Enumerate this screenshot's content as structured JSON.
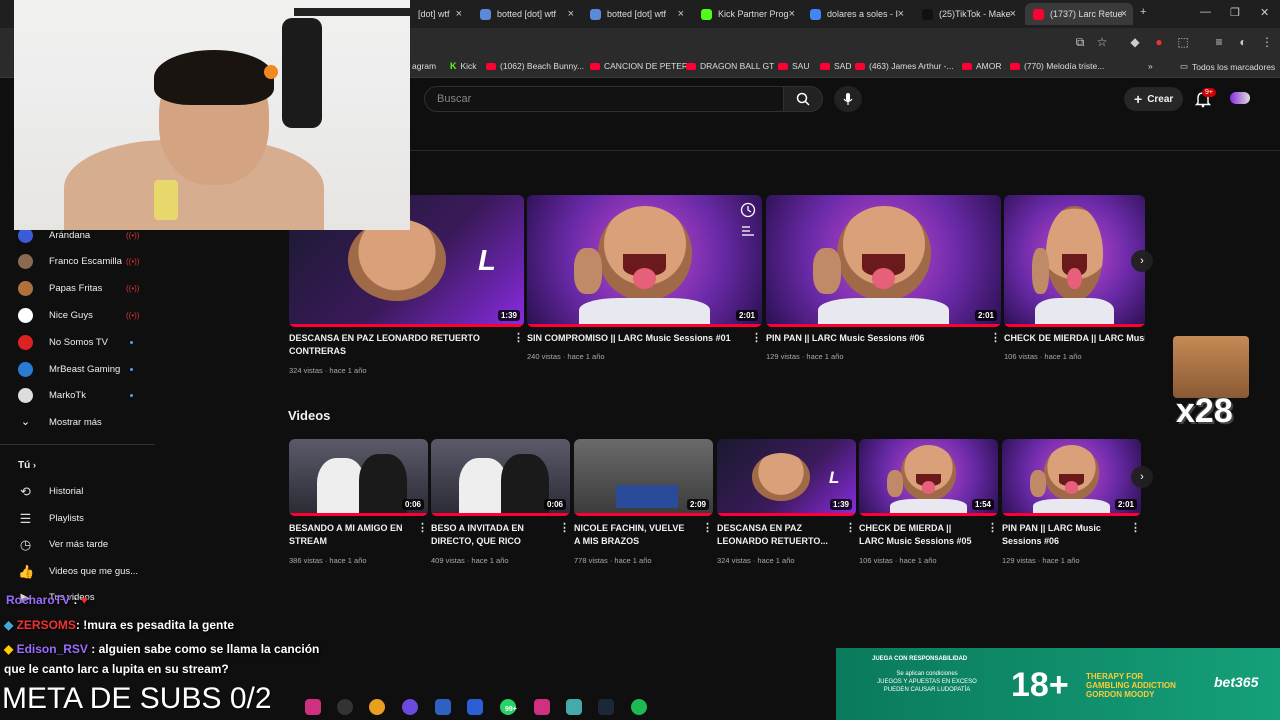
{
  "browser": {
    "tabs": [
      {
        "label": "[dot] wtf",
        "color": "#4a7bd0"
      },
      {
        "label": "botted [dot] wtf",
        "color": "#5a8ad8"
      },
      {
        "label": "botted [dot] wtf",
        "color": "#5a8ad8"
      },
      {
        "label": "Kick Partner Prog",
        "color": "#53fc18"
      },
      {
        "label": "dolares a soles - I",
        "color": "#4285f4"
      },
      {
        "label": "(25)TikTok - Make",
        "color": "#111111"
      },
      {
        "label": "(1737) Larc Retue",
        "color": "#ff0033"
      }
    ],
    "tab_close": "×",
    "new_tab": "+",
    "window_controls": {
      "minimize": "—",
      "maximize": "❐",
      "close": "✕"
    },
    "bookmarks": [
      {
        "label": "agram",
        "type": "plain"
      },
      {
        "label": "Kick",
        "type": "kick"
      },
      {
        "label": "(1062) Beach Bunny...",
        "type": "yt"
      },
      {
        "label": "CANCION DE PETER",
        "type": "yt"
      },
      {
        "label": "DRAGON BALL GT",
        "type": "yt"
      },
      {
        "label": "SAU",
        "type": "yt"
      },
      {
        "label": "SAD",
        "type": "yt"
      },
      {
        "label": "(463) James Arthur -...",
        "type": "yt"
      },
      {
        "label": "AMOR",
        "type": "yt"
      },
      {
        "label": "(770) Melodía triste...",
        "type": "yt"
      }
    ],
    "bookmarks_more": "»",
    "all_bookmarks": "Todos los marcadores"
  },
  "header": {
    "search_placeholder": "Buscar",
    "create_label": "Crear",
    "notif_badge": "9+"
  },
  "sidebar": {
    "subscriptions": [
      {
        "label": "Arándana",
        "status": "live",
        "color": "#3b5bdb"
      },
      {
        "label": "Franco Escamilla",
        "status": "live",
        "color": "#8a6a50"
      },
      {
        "label": "Papas Fritas",
        "status": "live",
        "color": "#b0703a"
      },
      {
        "label": "Nice Guys",
        "status": "live",
        "color": "#ffffff"
      },
      {
        "label": "No Somos TV",
        "status": "dot",
        "color": "#d22"
      },
      {
        "label": "MrBeast Gaming",
        "status": "dot",
        "color": "#2a7bd4"
      },
      {
        "label": "MarkoTk",
        "status": "dot",
        "color": "#dddddd"
      }
    ],
    "show_more": "Mostrar más",
    "you_label": "Tú",
    "library": [
      {
        "label": "Historial",
        "icon": "history-icon",
        "glyph": "⟲"
      },
      {
        "label": "Playlists",
        "icon": "playlists-icon",
        "glyph": "☰"
      },
      {
        "label": "Ver más tarde",
        "icon": "clock-icon",
        "glyph": "◷"
      },
      {
        "label": "Videos que me gus...",
        "icon": "thumbs-up-icon",
        "glyph": "👍"
      },
      {
        "label": "Tus videos",
        "icon": "video-icon",
        "glyph": "▶"
      }
    ]
  },
  "shorts_row": [
    {
      "title": "DESCANSA EN PAZ LEONARDO RETUERTO CONTRERAS",
      "meta": "324 vistas · hace 1 año",
      "duration": "1:39"
    },
    {
      "title": "SIN COMPROMISO || LARC Music Sessions #01",
      "meta": "240 vistas · hace 1 año",
      "duration": "2:01"
    },
    {
      "title": "PIN PAN || LARC Music Sessions #06",
      "meta": "129 vistas · hace 1 año",
      "duration": "2:01"
    },
    {
      "title": "CHECK DE MIERDA || LARC Music",
      "meta": "106 vistas · hace 1 año",
      "duration": ""
    }
  ],
  "videos_section": {
    "title": "Videos",
    "items": [
      {
        "title": "BESANDO A MI AMIGO EN STREAM",
        "meta": "386 vistas · hace 1 año",
        "duration": "0:06"
      },
      {
        "title": "BESO A INVITADA EN DIRECTO, QUE RICO",
        "meta": "409 vistas · hace 1 año",
        "duration": "0:06"
      },
      {
        "title": "NICOLE FACHIN, VUELVE A MIS BRAZOS",
        "meta": "778 vistas · hace 1 año",
        "duration": "2:09"
      },
      {
        "title": "DESCANSA EN PAZ LEONARDO RETUERTO...",
        "meta": "324 vistas · hace 1 año",
        "duration": "1:39"
      },
      {
        "title": "CHECK DE MIERDA || LARC Music Sessions #05",
        "meta": "106 vistas · hace 1 año",
        "duration": "1:54"
      },
      {
        "title": "PIN PAN || LARC Music Sessions #06",
        "meta": "129 vistas · hace 1 año",
        "duration": "2:01"
      }
    ]
  },
  "overlay": {
    "chat": [
      {
        "user": "RocharoTV",
        "sep": ":",
        "text": ""
      },
      {
        "user": "ZERSOMS",
        "sep": ":",
        "text": "!mura es pesadita la gente"
      },
      {
        "user": "Edison_RSV",
        "sep": ":",
        "text": "alguien sabe como se llama la canción"
      },
      {
        "user": "",
        "sep": "",
        "text": "que le canto larc a lupita en su stream?"
      }
    ],
    "meta_subs": "META DE SUBS 0/2",
    "emote_count": "x28",
    "ad": {
      "top": "JUEGA CON RESPONSABILIDAD",
      "left": "Se aplican condiciones\nJUEGOS Y APUESTAS EN EXCESO\nPUEDEN CAUSAR LUDOPATÍA",
      "big": "18+",
      "therapy": "THERAPY FOR\nGAMBLING ADDICTION\nGORDON MOODY",
      "brand": "bet365"
    },
    "taskbar_badge": "99+"
  }
}
